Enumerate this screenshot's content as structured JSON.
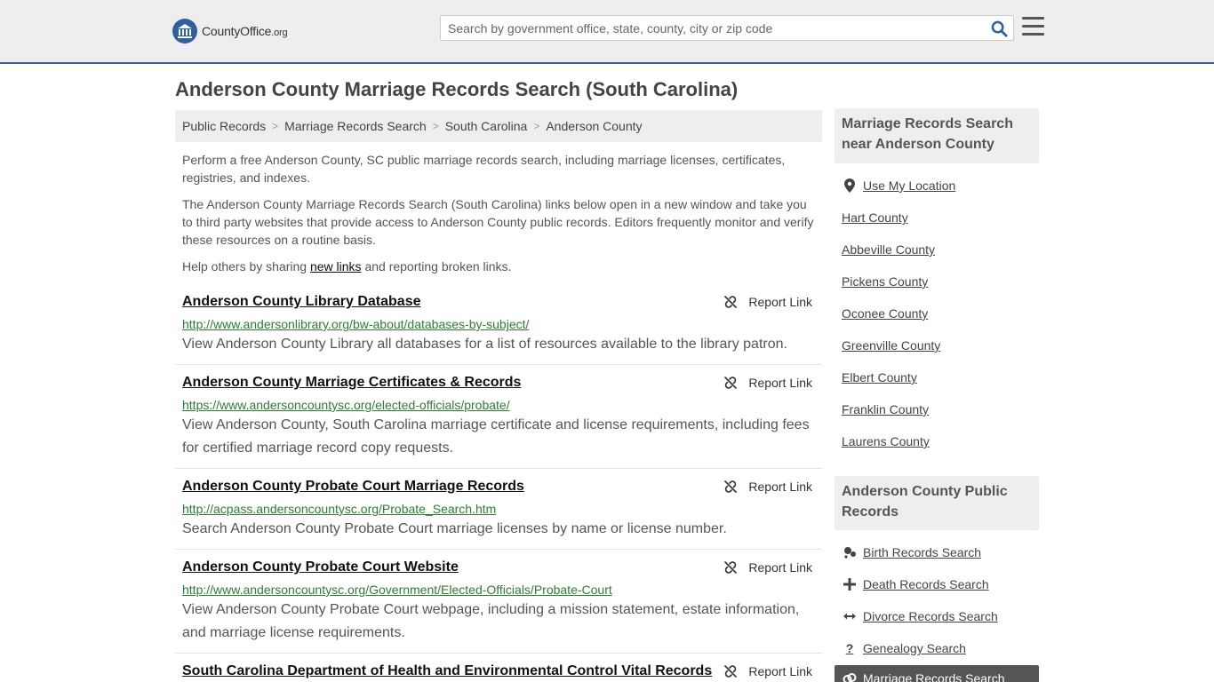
{
  "header": {
    "logo_name": "CountyOffice",
    "logo_tld": ".org",
    "search_placeholder": "Search by government office, state, county, city or zip code"
  },
  "page_title": "Anderson County Marriage Records Search (South Carolina)",
  "breadcrumb": [
    "Public Records",
    "Marriage Records Search",
    "South Carolina",
    "Anderson County"
  ],
  "intro": {
    "p1": "Perform a free Anderson County, SC public marriage records search, including marriage licenses, certificates, registries, and indexes.",
    "p2": "The Anderson County Marriage Records Search (South Carolina) links below open in a new window and take you to third party websites that provide access to Anderson County public records. Editors frequently monitor and verify these resources on a routine basis.",
    "p3_before": "Help others by sharing ",
    "p3_link": "new links",
    "p3_after": " and reporting broken links."
  },
  "report_label": "Report Link",
  "results": [
    {
      "title": "Anderson County Library Database",
      "url": "http://www.andersonlibrary.org/bw-about/databases-by-subject/",
      "desc": "View Anderson County Library all databases for a list of resources available to the library patron."
    },
    {
      "title": "Anderson County Marriage Certificates & Records",
      "url": "https://www.andersoncountysc.org/elected-officials/probate/",
      "desc": "View Anderson County, South Carolina marriage certificate and license requirements, including fees for certified marriage record copy requests."
    },
    {
      "title": "Anderson County Probate Court Marriage Records",
      "url": "http://acpass.andersoncountysc.org/Probate_Search.htm",
      "desc": "Search Anderson County Probate Court marriage licenses by name or license number."
    },
    {
      "title": "Anderson County Probate Court Website",
      "url": "http://www.andersoncountysc.org/Government/Elected-Officials/Probate-Court",
      "desc": "View Anderson County Probate Court webpage, including a mission statement, estate information, and marriage license requirements."
    },
    {
      "title": "South Carolina Department of Health and Environmental Control Vital Records",
      "url": "",
      "desc": ""
    }
  ],
  "sidebar": {
    "nearby_heading": "Marriage Records Search near Anderson County",
    "use_location": "Use My Location",
    "nearby": [
      "Hart County",
      "Abbeville County",
      "Pickens County",
      "Oconee County",
      "Greenville County",
      "Elbert County",
      "Franklin County",
      "Laurens County"
    ],
    "public_heading": "Anderson County Public Records",
    "public_links": [
      {
        "label": "Birth Records Search",
        "icon": "baby-icon"
      },
      {
        "label": "Death Records Search",
        "icon": "cross-icon"
      },
      {
        "label": "Divorce Records Search",
        "icon": "arrows-split-icon"
      },
      {
        "label": "Genealogy Search",
        "icon": "question-icon"
      }
    ],
    "active_link": "Marriage Records Search"
  },
  "colors": {
    "accent": "#2f5f9e",
    "url_green": "#2e7d32",
    "header_bg": "#eeeeee"
  }
}
